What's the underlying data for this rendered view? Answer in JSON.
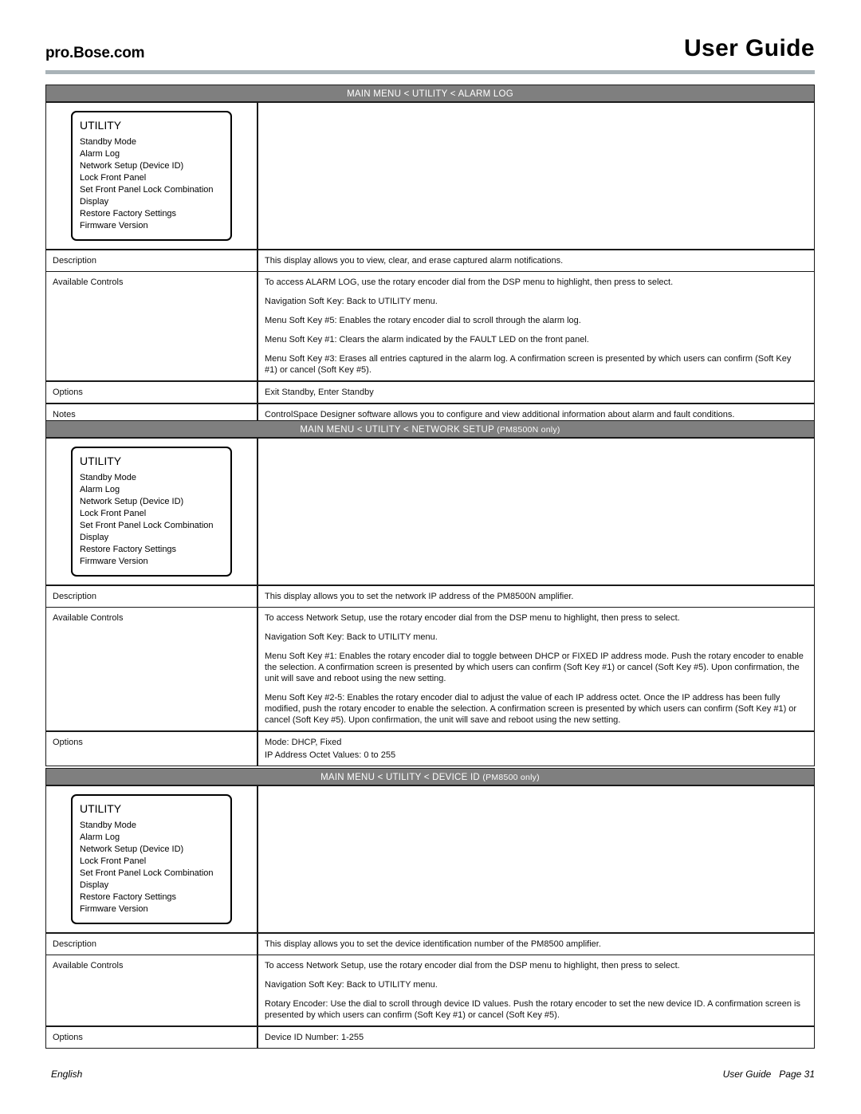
{
  "header": {
    "brand": "pro.Bose.com",
    "guide_title": "User Guide",
    "rule_color": "#a9b3b8"
  },
  "footer": {
    "language": "English",
    "right_text": "User Guide   Page 31"
  },
  "menu_panel": {
    "title": "UTILITY",
    "items": [
      "Standby Mode",
      "Alarm Log",
      "Network Setup (Device ID)",
      "Lock Front Panel",
      "Set Front Panel Lock Combination",
      "Display",
      "Restore Factory Settings",
      "Firmware Version"
    ]
  },
  "row_labels": {
    "description": "Description",
    "available_controls": "Available Controls",
    "options": "Options",
    "notes": "Notes"
  },
  "tables": [
    {
      "header": "MAIN MENU < UTILITY < ALARM LOG",
      "header_suffix": "",
      "description": "This display allows you to view, clear, and erase captured alarm notifications.",
      "controls": [
        "To access ALARM LOG, use the rotary encoder dial from the DSP menu to highlight, then press to select.",
        "Navigation Soft Key: Back to UTILITY menu.",
        "Menu Soft Key #5: Enables the rotary encoder dial to scroll through the alarm log.",
        "Menu Soft Key #1: Clears the alarm indicated by the FAULT LED on the front panel.",
        "Menu Soft Key #3: Erases all entries captured in the alarm log. A confirmation screen is presented by which users can confirm (Soft Key #1) or cancel (Soft Key #5)."
      ],
      "options": [
        "Exit Standby, Enter Standby"
      ],
      "notes": "ControlSpace Designer software allows you to configure and view additional information about alarm and fault conditions."
    },
    {
      "header": "MAIN MENU < UTILITY < NETWORK SETUP ",
      "header_suffix": "(PM8500N only)",
      "description": "This display allows you to set the network IP address of the PM8500N amplifier.",
      "controls": [
        "To access Network Setup, use the rotary encoder dial from the DSP menu to highlight, then press to select.",
        "Navigation Soft Key: Back to UTILITY menu.",
        "Menu Soft Key #1: Enables the rotary encoder dial to toggle between DHCP or FIXED IP address mode. Push the rotary encoder to enable the selection. A confirmation screen is presented by which users can confirm (Soft Key #1) or cancel (Soft Key #5). Upon confirmation, the unit will save and reboot using the new setting.",
        "Menu Soft Key #2-5: Enables the rotary encoder dial to adjust the value of each IP address octet. Once the IP address has been fully modified, push the rotary encoder to enable the selection. A confirmation screen is presented by which users can confirm (Soft Key #1) or cancel (Soft Key #5). Upon confirmation, the unit will save and reboot using the new setting."
      ],
      "options": [
        "Mode: DHCP, Fixed",
        "IP Address Octet Values: 0 to 255"
      ],
      "notes": null
    },
    {
      "header": "MAIN MENU < UTILITY < DEVICE ID ",
      "header_suffix": "(PM8500 only)",
      "description": "This display allows you to set the device identification number of the PM8500 amplifier.",
      "controls": [
        "To access Network Setup, use the rotary encoder dial from the DSP menu to highlight, then press to select.",
        "Navigation Soft Key: Back to UTILITY menu.",
        "Rotary Encoder: Use the dial to scroll through device ID values. Push the rotary encoder to set the new device ID. A confirmation screen is presented by which users can confirm (Soft Key #1) or cancel (Soft Key #5)."
      ],
      "options": [
        "Device ID Number: 1-255"
      ],
      "notes": null
    }
  ]
}
